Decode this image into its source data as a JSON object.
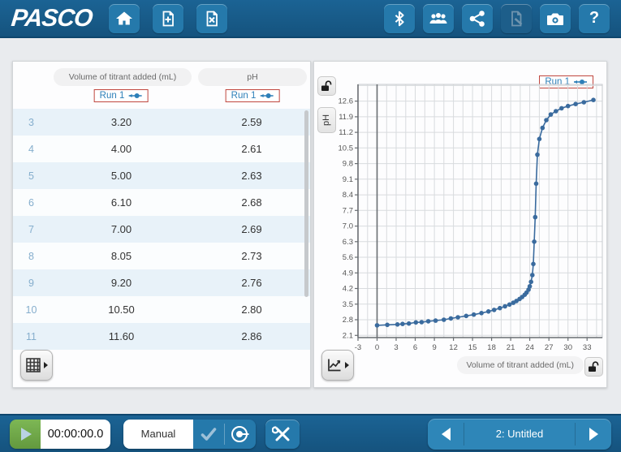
{
  "top_toolbar": {
    "logo": "PASCO",
    "help_label": "?",
    "icons": [
      "home-icon",
      "new-file-icon",
      "close-file-icon",
      "bluetooth-icon",
      "users-icon",
      "share-icon",
      "journal-edit-icon",
      "camera-icon",
      "help-icon"
    ]
  },
  "table_panel": {
    "column_headers": {
      "volume": "Volume of titrant added (mL)",
      "ph": "pH"
    },
    "runs": [
      {
        "label": "Run 1"
      },
      {
        "label": "Run 1"
      }
    ],
    "rows": [
      {
        "index": "3",
        "volume": "3.20",
        "ph": "2.59"
      },
      {
        "index": "4",
        "volume": "4.00",
        "ph": "2.61"
      },
      {
        "index": "5",
        "volume": "5.00",
        "ph": "2.63"
      },
      {
        "index": "6",
        "volume": "6.10",
        "ph": "2.68"
      },
      {
        "index": "7",
        "volume": "7.00",
        "ph": "2.69"
      },
      {
        "index": "8",
        "volume": "8.05",
        "ph": "2.73"
      },
      {
        "index": "9",
        "volume": "9.20",
        "ph": "2.76"
      },
      {
        "index": "10",
        "volume": "10.50",
        "ph": "2.80"
      },
      {
        "index": "11",
        "volume": "11.60",
        "ph": "2.86"
      }
    ]
  },
  "graph_panel": {
    "legend_label": "Run 1",
    "y_axis_label": "pH",
    "x_axis_label": "Volume of titrant added (mL)"
  },
  "bottom_toolbar": {
    "timer_value": "00:00:00.0",
    "sampling_mode": "Manual",
    "page_label": "2: Untitled"
  },
  "colors": {
    "toolbar_bg": "#17598a",
    "button_blue": "#2579ab",
    "accent_green": "#6fae46",
    "series_blue": "#3a6b9e",
    "grid_gray": "#d8dbde",
    "axis_dark": "#6a6e72",
    "run_border_red": "#c0463e",
    "run_text_blue": "#2d7fb8",
    "row_alt_blue": "#e8f2f9"
  },
  "chart_data": {
    "type": "line",
    "title": "",
    "xlabel": "Volume of titrant added (mL)",
    "ylabel": "pH",
    "xlim": [
      -3,
      35.4
    ],
    "ylim": [
      2.0,
      13.35
    ],
    "xticks": [
      -3,
      0,
      3,
      6,
      9,
      12,
      15,
      18,
      21,
      24,
      27,
      30,
      33
    ],
    "yticks": [
      2.1,
      2.8,
      3.5,
      4.2,
      4.9,
      5.6,
      6.3,
      7.0,
      7.7,
      8.4,
      9.1,
      9.8,
      10.5,
      11.2,
      11.9,
      12.6
    ],
    "x_grid_step": 1.5,
    "y_grid_step": 0.7,
    "grid": true,
    "legend_position": "top-right",
    "series": [
      {
        "name": "Run 1",
        "x": [
          0.0,
          1.6,
          3.2,
          4.0,
          5.0,
          6.1,
          7.0,
          8.05,
          9.2,
          10.5,
          11.6,
          12.7,
          14.0,
          15.2,
          16.4,
          17.5,
          18.4,
          19.3,
          20.1,
          20.8,
          21.4,
          21.9,
          22.4,
          22.8,
          23.2,
          23.5,
          23.8,
          24.0,
          24.2,
          24.4,
          24.55,
          24.7,
          24.85,
          25.0,
          25.2,
          25.5,
          26.0,
          26.6,
          27.3,
          28.1,
          29.0,
          30.0,
          31.2,
          32.5,
          34.0
        ],
        "y": [
          2.55,
          2.57,
          2.59,
          2.61,
          2.63,
          2.68,
          2.69,
          2.73,
          2.76,
          2.8,
          2.86,
          2.91,
          2.97,
          3.03,
          3.1,
          3.17,
          3.24,
          3.32,
          3.4,
          3.48,
          3.56,
          3.64,
          3.73,
          3.82,
          3.92,
          4.02,
          4.15,
          4.3,
          4.5,
          4.8,
          5.3,
          6.3,
          7.4,
          8.9,
          10.2,
          10.9,
          11.4,
          11.75,
          12.0,
          12.15,
          12.28,
          12.38,
          12.47,
          12.55,
          12.65
        ]
      }
    ]
  }
}
